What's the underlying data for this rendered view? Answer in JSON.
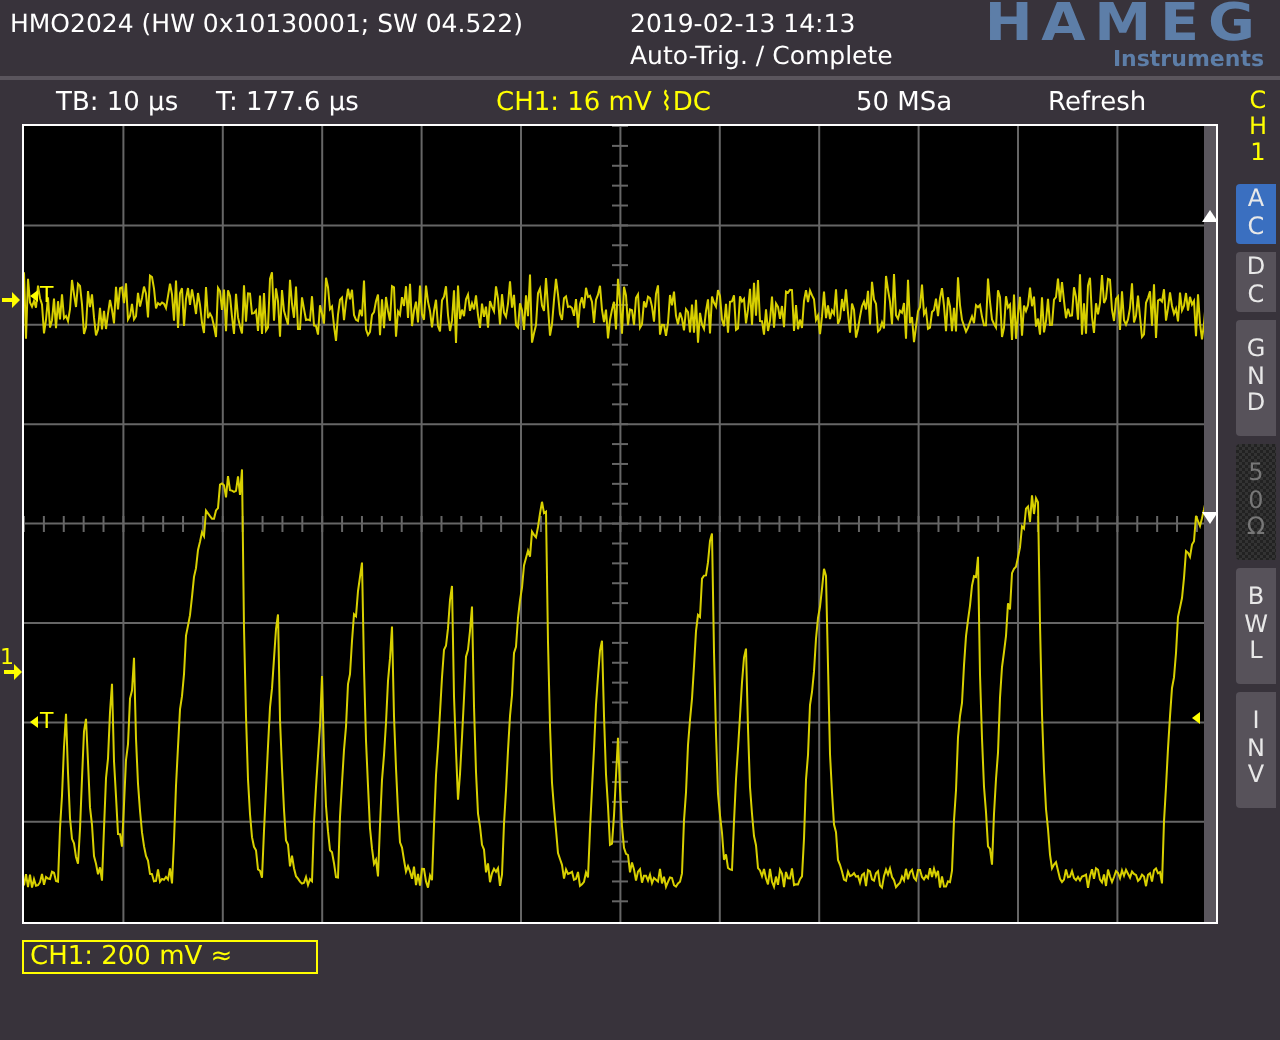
{
  "header": {
    "title": "HMO2024 (HW 0x10130001; SW 04.522)",
    "datetime": "2019-02-13 14:13",
    "status": "Auto-Trig. / Complete",
    "logo": "HAMEG",
    "logo_sub": "Instruments"
  },
  "info_bar": {
    "timebase": "TB: 10 µs",
    "trigger_time": "T: 177.6 µs",
    "trigger_channel": "CH1: 16 mV ⌇DC",
    "sample_rate": "50 MSa",
    "mode": "Refresh"
  },
  "markers": {
    "ground_label": "1",
    "trigger_label": "T",
    "trigger_label_2": "T"
  },
  "side_panel": {
    "channel": "CH1",
    "buttons": [
      {
        "label": "AC",
        "selected": true,
        "disabled": false
      },
      {
        "label": "DC",
        "selected": false,
        "disabled": false
      },
      {
        "label": "GND",
        "selected": false,
        "disabled": false
      },
      {
        "label": "50Ω",
        "selected": false,
        "disabled": true
      },
      {
        "label": "BWL",
        "selected": false,
        "disabled": false
      },
      {
        "label": "INV",
        "selected": false,
        "disabled": false
      }
    ]
  },
  "channel_box": "CH1: 200 mV ≈"
}
